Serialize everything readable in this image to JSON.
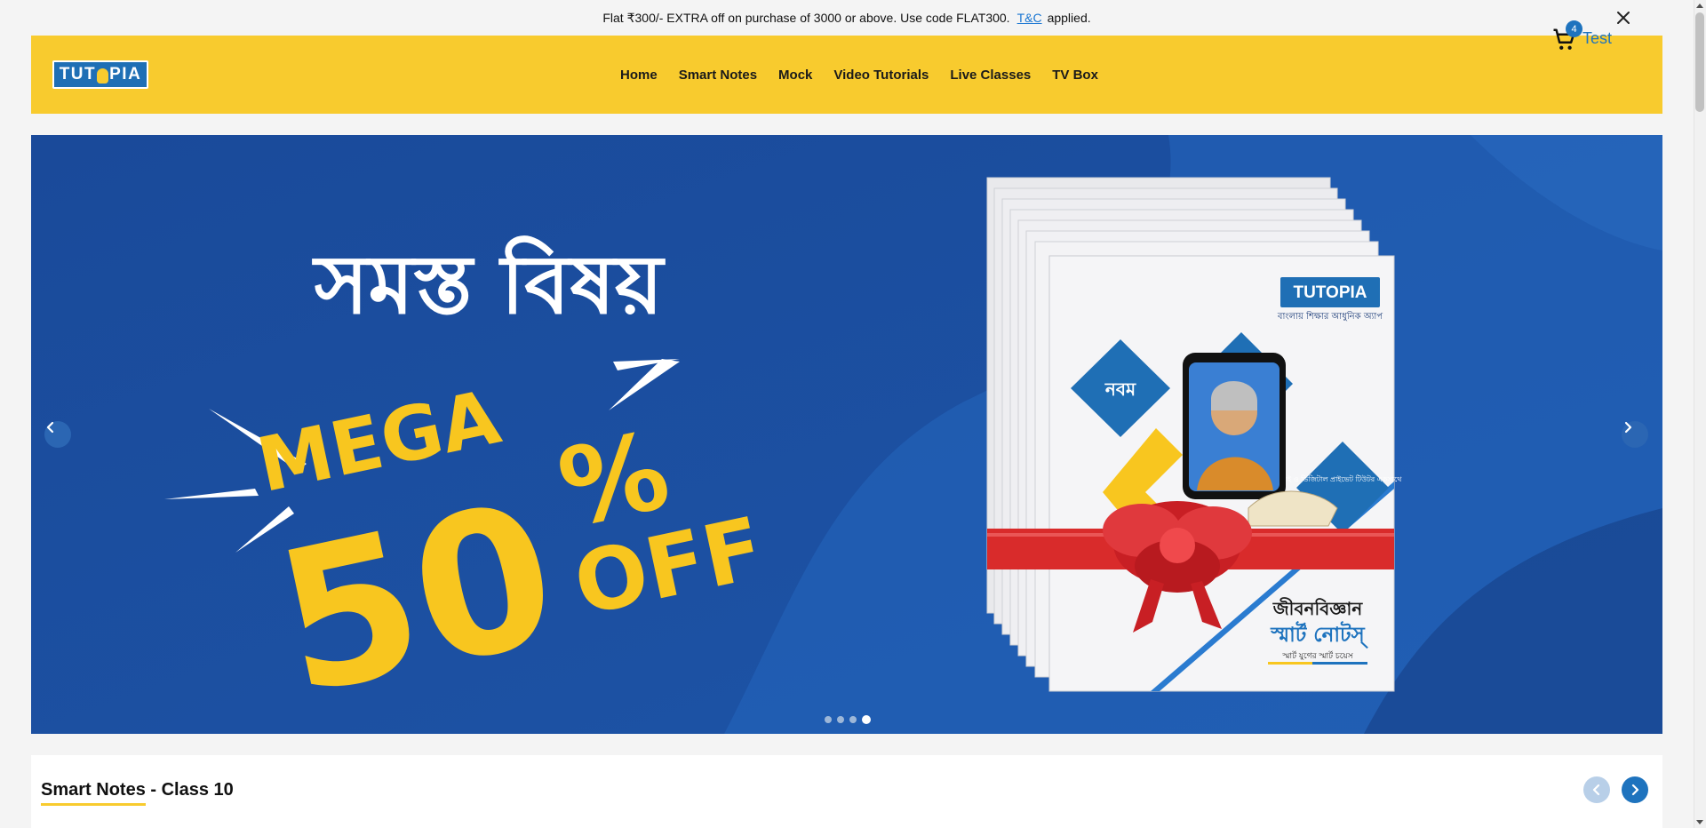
{
  "promo": {
    "text": "Flat ₹300/- EXTRA off on purchase of 3000 or above. Use code FLAT300.",
    "tc_label": "T&C",
    "suffix": "applied."
  },
  "header": {
    "logo_text": "TUTOPIA",
    "nav": [
      "Home",
      "Smart Notes",
      "Mock",
      "Video Tutorials",
      "Live Classes",
      "TV Box"
    ],
    "cart_count": "4",
    "user_name": "Test"
  },
  "banner": {
    "headline": "সমস্ত বিষয়",
    "mega": "MEGA",
    "percent_number": "50",
    "percent_sign": "%",
    "off": "OFF",
    "book": {
      "brand": "TUTOPIA",
      "brand_tagline": "বাংলায় শিক্ষার আধুনিক অ্যাপ",
      "class_label": "নবম",
      "side_note": "বই ও ডিজিটাল প্রাইভেট টিউটর একসাথে",
      "subject": "জীবনবিজ্ঞান",
      "series": "স্মার্ট নোটস্",
      "series_tagline": "স্মার্ট যুগের স্মার্ট চয়েস"
    },
    "slide_count": 4,
    "active_slide": 4
  },
  "section": {
    "title": "Smart Notes - Class 10"
  },
  "colors": {
    "header_bg": "#f8cb2e",
    "brand_blue": "#1e73be",
    "banner_bg": "#1d4f9e",
    "accent_yellow": "#f8c61f"
  }
}
